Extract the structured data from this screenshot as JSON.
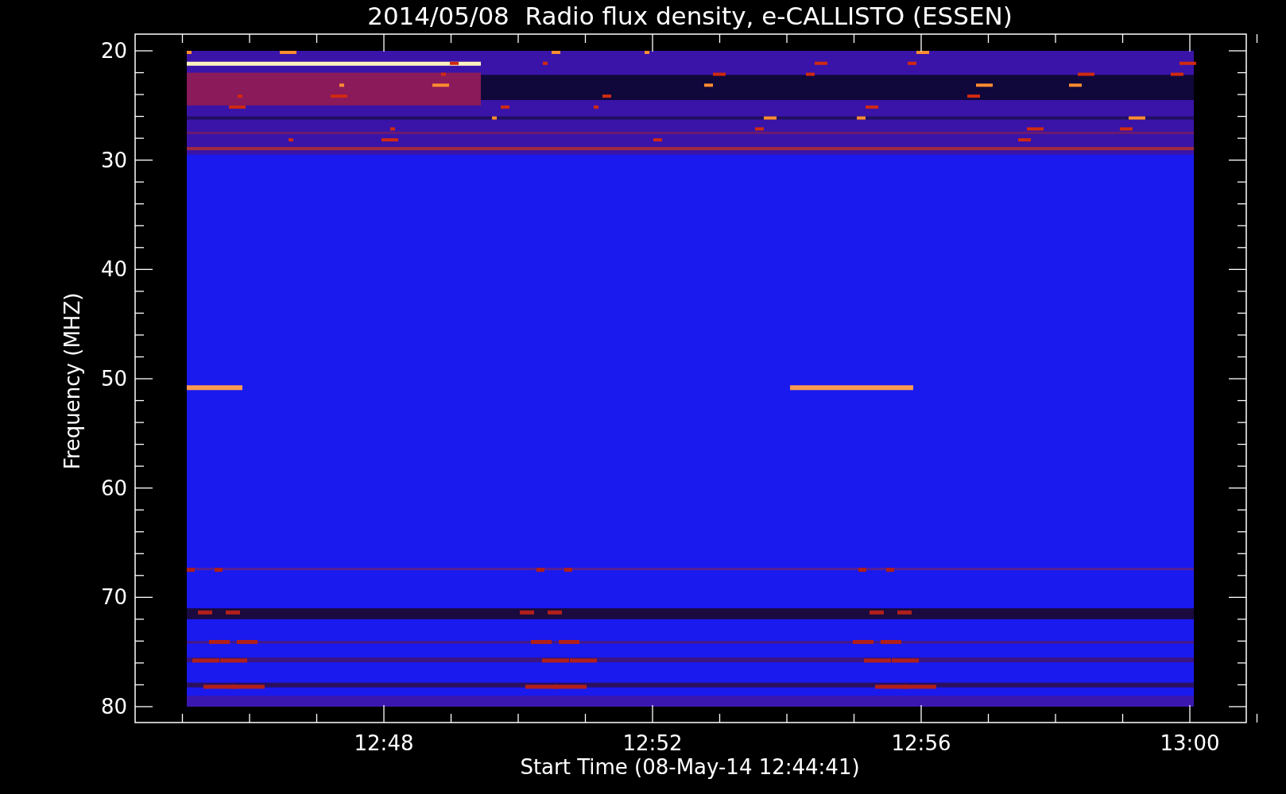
{
  "title": "2014/05/08  Radio flux density, e-CALLISTO (ESSEN)",
  "y_axis": {
    "label": "Frequency (MHZ)",
    "ticks": [
      "20",
      "30",
      "40",
      "50",
      "60",
      "70",
      "80"
    ]
  },
  "x_axis": {
    "label": "Start Time (08-May-14 12:44:41)",
    "ticks": [
      "12:48",
      "12:52",
      "12:56",
      "13:00"
    ]
  }
}
